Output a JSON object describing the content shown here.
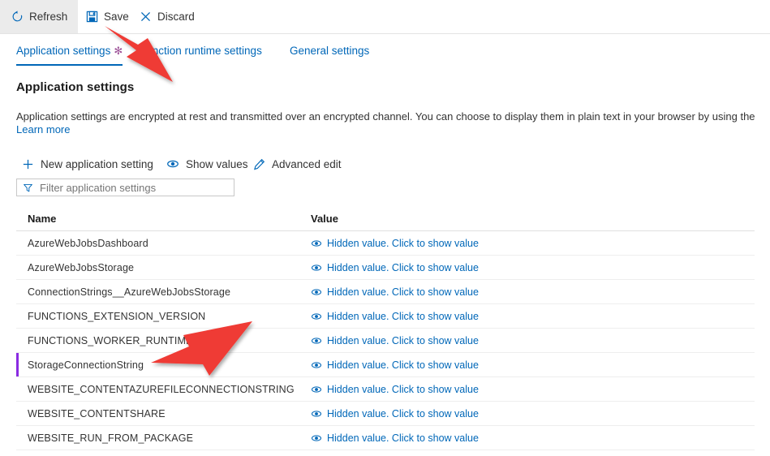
{
  "commandbar": {
    "buttons": [
      {
        "label": "Refresh",
        "icon": "refresh-icon",
        "state": "hover"
      },
      {
        "label": "Save",
        "icon": "save-icon",
        "state": "normal"
      },
      {
        "label": "Discard",
        "icon": "discard-icon",
        "state": "normal"
      }
    ]
  },
  "tabs": [
    {
      "label": "Application settings",
      "active": true,
      "modified_marker": "✻"
    },
    {
      "label": "Function runtime settings",
      "active": false
    },
    {
      "label": "General settings",
      "active": false
    }
  ],
  "content": {
    "title": "Application settings",
    "description": "Application settings are encrypted at rest and transmitted over an encrypted channel. You can choose to display them in plain text in your browser by using the",
    "learn_more": "Learn more"
  },
  "actions": [
    {
      "label": "New application setting",
      "icon": "plus-icon"
    },
    {
      "label": "Show values",
      "icon": "eye-icon"
    },
    {
      "label": "Advanced edit",
      "icon": "pencil-icon"
    }
  ],
  "filter": {
    "placeholder": "Filter application settings",
    "value": "",
    "icon": "filter-icon"
  },
  "table": {
    "columns": [
      "Name",
      "Value"
    ],
    "hidden_value_label": "Hidden value. Click to show value",
    "rows": [
      {
        "name": "AzureWebJobsDashboard",
        "value": "Hidden value. Click to show value",
        "modified": false
      },
      {
        "name": "AzureWebJobsStorage",
        "value": "Hidden value. Click to show value",
        "modified": false
      },
      {
        "name": "ConnectionStrings__AzureWebJobsStorage",
        "value": "Hidden value. Click to show value",
        "modified": false
      },
      {
        "name": "FUNCTIONS_EXTENSION_VERSION",
        "value": "Hidden value. Click to show value",
        "modified": false
      },
      {
        "name": "FUNCTIONS_WORKER_RUNTIME",
        "value": "Hidden value. Click to show value",
        "modified": false
      },
      {
        "name": "StorageConnectionString",
        "value": "Hidden value. Click to show value",
        "modified": true
      },
      {
        "name": "WEBSITE_CONTENTAZUREFILECONNECTIONSTRING",
        "value": "Hidden value. Click to show value",
        "modified": false
      },
      {
        "name": "WEBSITE_CONTENTSHARE",
        "value": "Hidden value. Click to show value",
        "modified": false
      },
      {
        "name": "WEBSITE_RUN_FROM_PACKAGE",
        "value": "Hidden value. Click to show value",
        "modified": false
      }
    ]
  },
  "annotations": [
    {
      "name": "arrow-to-save-button",
      "color": "#ef3b36"
    },
    {
      "name": "arrow-to-storage-connection-string-row",
      "color": "#ef3b36"
    }
  ],
  "colors": {
    "link": "#0067b8",
    "accent": "#0067b8",
    "modified_marker": "#9b4f96",
    "row_modified_bar": "#8a2be2",
    "annotation": "#ef3b36"
  }
}
